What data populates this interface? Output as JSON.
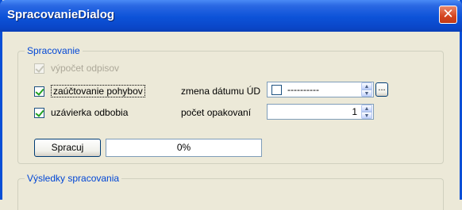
{
  "window": {
    "title": "SpracovanieDialog",
    "close_glyph": "✕"
  },
  "group_processing": {
    "title": "Spracovanie",
    "chk_depreciation": {
      "label": "výpočet odpisov",
      "checked": true,
      "enabled": false
    },
    "chk_posting": {
      "label": "zaúčtovanie pohybov",
      "checked": true,
      "enabled": true
    },
    "chk_closing": {
      "label": "uzávierka odbobia",
      "checked": true,
      "enabled": true
    },
    "date_change": {
      "label": "zmena dátumu ÚD",
      "value": "----------",
      "browse_label": "..."
    },
    "repeat_count": {
      "label": "počet opakovaní",
      "value": "1"
    },
    "run_button": "Spracuj",
    "progress_text": "0%",
    "progress_value": 0
  },
  "group_results": {
    "title": "Výsledky spracovania"
  },
  "colors": {
    "title_bar": "#0a47c9",
    "group_title": "#0046d5",
    "check_tick": "#21a121"
  }
}
